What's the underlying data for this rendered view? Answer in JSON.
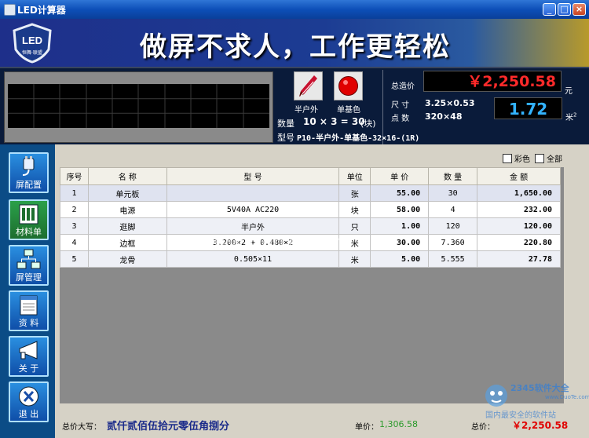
{
  "window": {
    "title": "LED计算器",
    "min_glyph": "_",
    "max_glyph": "□",
    "close_glyph": "×"
  },
  "banner": {
    "logo_text": "LED",
    "logo_subtext": "恒舞·联盟",
    "slogan": "做屏不求人，工作更轻松"
  },
  "info": {
    "btn_outdoor_label": "半户外",
    "btn_color_label": "单基色",
    "qty_label": "数量",
    "qty_value": "10 × 3 = 30",
    "qty_unit": "(块)",
    "model_label": "型号",
    "model_value": "P10-半户外-单基色-32×16-(1R)",
    "total_label": "总造价",
    "total_value": "￥2,250.58",
    "total_unit": "元",
    "size_label": "尺  寸",
    "size_value": "3.25×0.53",
    "pixels_label": "点  数",
    "pixels_value": "320×48",
    "area_value": "1.72",
    "area_unit": "米",
    "area_sup": "2"
  },
  "sidebar": {
    "items": [
      {
        "label": "屏配置",
        "icon": "plug-icon"
      },
      {
        "label": "材料单",
        "icon": "material-list-icon"
      },
      {
        "label": "屏管理",
        "icon": "network-icon"
      },
      {
        "label": "资  料",
        "icon": "document-icon"
      },
      {
        "label": "关  于",
        "icon": "megaphone-icon"
      },
      {
        "label": "退  出",
        "icon": "exit-icon"
      }
    ]
  },
  "filters": {
    "color_label": "彩色",
    "all_label": "全部"
  },
  "table": {
    "headers": [
      "序号",
      "名    称",
      "型    号",
      "单位",
      "单 价",
      "数 量",
      "金    额"
    ],
    "rows": [
      [
        "1",
        "单元板",
        "",
        "张",
        "55.00",
        "30",
        "1,650.00"
      ],
      [
        "2",
        "电源",
        "5V40A AC220",
        "块",
        "58.00",
        "4",
        "232.00"
      ],
      [
        "3",
        "逛脚",
        "半户外",
        "只",
        "1.00",
        "120",
        "120.00"
      ],
      [
        "4",
        "边框",
        "3.200×2  +  0.480×2",
        "米",
        "30.00",
        "7.360",
        "220.80"
      ],
      [
        "5",
        "龙骨",
        "0.505×11",
        "米",
        "5.00",
        "5.555",
        "27.78"
      ]
    ]
  },
  "footer": {
    "total_words_label": "总价大写：",
    "total_words_value": "贰仟贰佰伍拾元零伍角捌分",
    "unit_price_label": "单价：",
    "unit_price_value": "1,306.58",
    "total_label": "总价：",
    "total_value": "￥2,250.58"
  },
  "watermark": {
    "site": "www.DuoTe.com",
    "corner_text": "2345软件大全",
    "corner_sub": "国内最安全的软件站",
    "corner_site": "www.DuoTe.com"
  },
  "colors": {
    "banner_blue": "#1e2f8a",
    "price_red": "#ff2a2a",
    "area_blue": "#33b3ff",
    "sidebar_blue": "#0b4c86"
  }
}
